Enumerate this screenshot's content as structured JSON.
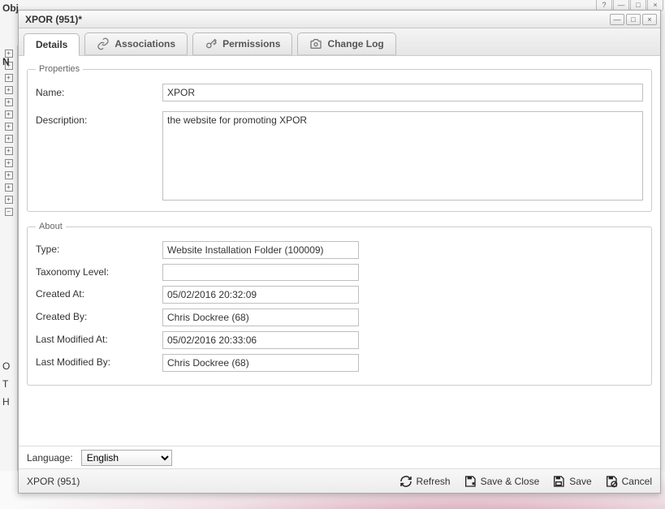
{
  "background": {
    "title_truncated": "Obj…",
    "nav_letters": {
      "n": "N",
      "o": "O",
      "t": "T",
      "h": "H"
    }
  },
  "dialog": {
    "title": "XPOR (951)*",
    "window_buttons": {
      "min": "—",
      "max": "□",
      "close": "×"
    },
    "tabs": [
      {
        "label": "Details",
        "icon": "details-icon"
      },
      {
        "label": "Associations",
        "icon": "link-icon"
      },
      {
        "label": "Permissions",
        "icon": "key-icon"
      },
      {
        "label": "Change Log",
        "icon": "camera-icon"
      }
    ],
    "properties": {
      "legend": "Properties",
      "name_label": "Name:",
      "name_value": "XPOR",
      "description_label": "Description:",
      "description_value": "the website for promoting XPOR"
    },
    "about": {
      "legend": "About",
      "type_label": "Type:",
      "type_value": "Website Installation Folder (100009)",
      "taxonomy_label": "Taxonomy Level:",
      "taxonomy_value": "",
      "created_at_label": "Created At:",
      "created_at_value": "05/02/2016 20:32:09",
      "created_by_label": "Created By:",
      "created_by_value": "Chris Dockree (68)",
      "modified_at_label": "Last Modified At:",
      "modified_at_value": "05/02/2016 20:33:06",
      "modified_by_label": "Last Modified By:",
      "modified_by_value": "Chris Dockree (68)"
    },
    "footer": {
      "language_label": "Language:",
      "language_value": "English",
      "status_title": "XPOR (951)",
      "refresh": "Refresh",
      "save_close": "Save & Close",
      "save": "Save",
      "cancel": "Cancel"
    }
  }
}
